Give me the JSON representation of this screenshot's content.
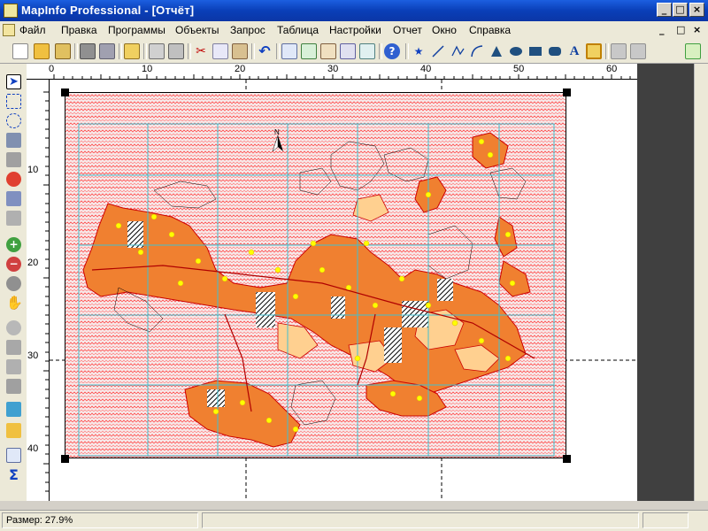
{
  "window": {
    "title": "MapInfo Professional - [Отчёт]",
    "controls": [
      "_",
      "□",
      "×"
    ]
  },
  "menu": {
    "items": [
      "Файл",
      "Правка",
      "Программы",
      "Объекты",
      "Запрос",
      "Таблица",
      "Настройки",
      "Отчет",
      "Окно",
      "Справка"
    ],
    "mdi_controls": [
      "_",
      "□",
      "×"
    ]
  },
  "ruler": {
    "horizontal": [
      "0",
      "10",
      "20",
      "30",
      "40",
      "50",
      "60"
    ],
    "vertical": [
      "10",
      "20",
      "30",
      "40"
    ]
  },
  "status": {
    "size": "Размер: 27.9%"
  },
  "map": {
    "north_label": "N"
  },
  "colors": {
    "titlebar": "#0a3fb8",
    "parcel_fill": "#f08030",
    "parcel_light": "#ffd090",
    "parcel_outline": "#cc0000",
    "hatch": "#ff4040",
    "grid": "#40c0d0",
    "point_marker": "#ffff00"
  }
}
